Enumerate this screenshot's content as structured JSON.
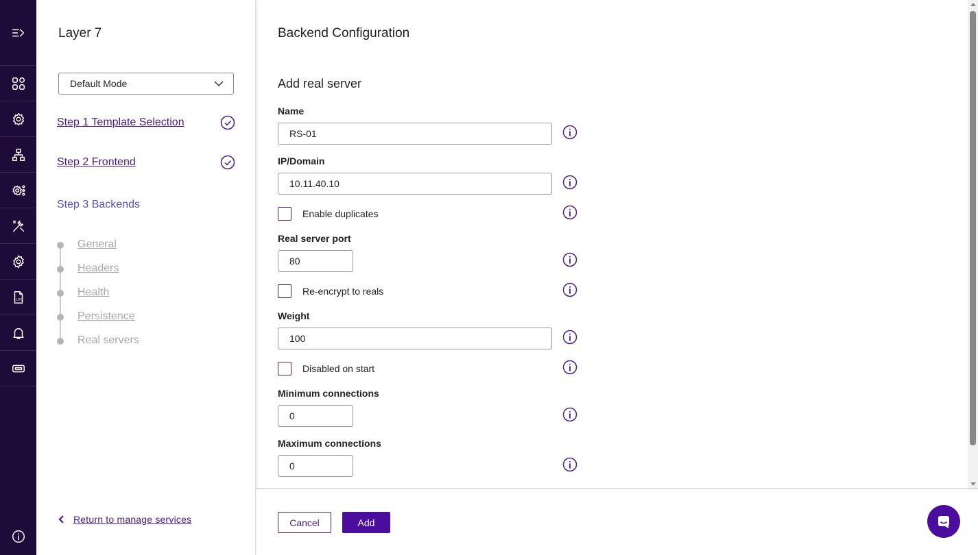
{
  "rail": {
    "items": [
      {
        "icon": "expand-menu-icon"
      },
      {
        "icon": "dashboard-icon"
      },
      {
        "icon": "services-gear-icon"
      },
      {
        "icon": "network-icon"
      },
      {
        "icon": "cluster-settings-icon"
      },
      {
        "icon": "tools-icon"
      },
      {
        "icon": "settings-gear-icon"
      },
      {
        "icon": "log-file-icon"
      },
      {
        "icon": "bell-icon"
      },
      {
        "icon": "license-ticket-icon"
      },
      {
        "icon": "info-icon"
      }
    ]
  },
  "wizard": {
    "title": "Layer 7",
    "mode": "Default Mode",
    "steps": [
      {
        "label": "Step 1 Template Selection",
        "status": "complete"
      },
      {
        "label": "Step 2 Frontend",
        "status": "complete"
      },
      {
        "label": "Step 3 Backends",
        "status": "current"
      }
    ],
    "substeps": [
      "General",
      "Headers",
      "Health",
      "Persistence",
      "Real servers"
    ],
    "return_label": "Return to manage services"
  },
  "main": {
    "title": "Backend Configuration",
    "section_title": "Add real server",
    "fields": {
      "name": {
        "label": "Name",
        "value": "RS-01"
      },
      "ip_domain": {
        "label": "IP/Domain",
        "value": "10.11.40.10"
      },
      "enable_duplicates": {
        "label": "Enable duplicates",
        "checked": false
      },
      "port": {
        "label": "Real server port",
        "value": "80"
      },
      "reencrypt": {
        "label": "Re-encrypt to reals",
        "checked": false
      },
      "weight": {
        "label": "Weight",
        "value": "100"
      },
      "disabled_on_start": {
        "label": "Disabled on start",
        "checked": false
      },
      "min_connections": {
        "label": "Minimum connections",
        "value": "0"
      },
      "max_connections": {
        "label": "Maximum connections",
        "value": "0"
      }
    }
  },
  "footer": {
    "cancel_label": "Cancel",
    "add_label": "Add"
  },
  "colors": {
    "rail_bg": "#1e0b3a",
    "accent": "#4a0d9e",
    "link": "#4a1b8c"
  }
}
